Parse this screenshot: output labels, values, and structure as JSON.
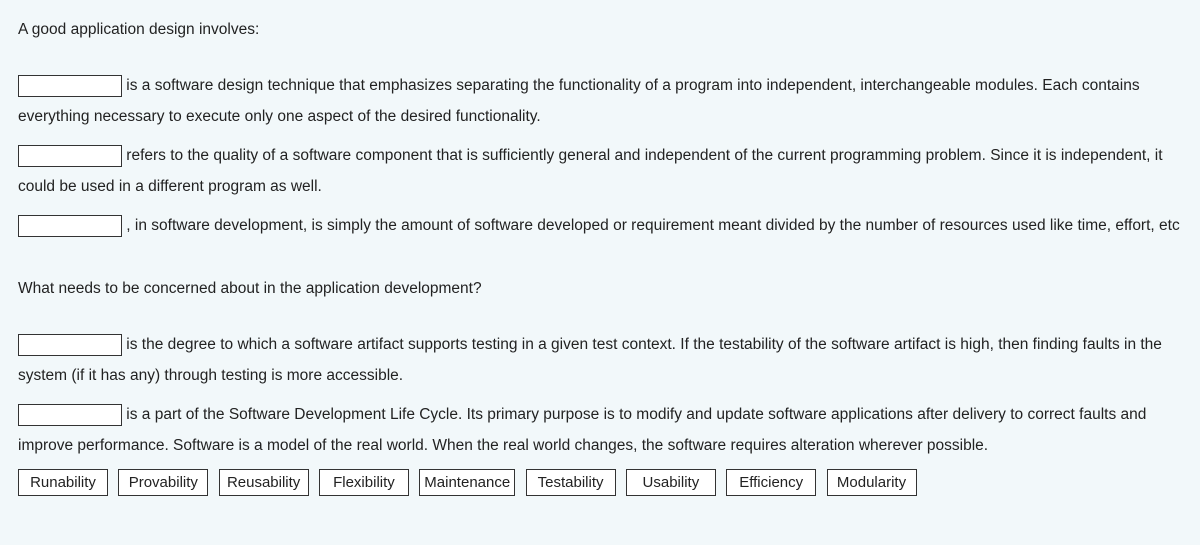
{
  "heading1": "A good application design involves:",
  "para1_after": " is a software design technique that emphasizes separating the functionality of a program into independent, interchangeable modules. Each contains everything necessary to execute only one aspect of the desired functionality.",
  "para2_after": " refers to the quality of a software component that is sufficiently general and independent of the current programming problem. Since it is independent, it could be used in a different program as well.",
  "para3_after": " , in software development, is simply the amount of software developed or requirement meant divided by the number of resources used like time, effort, etc",
  "heading2": "What needs to be concerned about in the application development?",
  "para4_after": " is the degree to which a software artifact supports testing in a given test context. If the testability of the software artifact is high, then finding faults in the system (if it has any) through testing is more accessible.",
  "para5_after": " is a part of the Software Development Life Cycle. Its primary purpose is to modify and update software applications after delivery to correct faults and improve performance. Software is a model of the real world. When the real world changes, the software requires alteration wherever possible.",
  "word_bank": {
    "0": "Runability",
    "1": "Provability",
    "2": "Reusability",
    "3": "Flexibility",
    "4": "Maintenance",
    "5": "Testability",
    "6": "Usability",
    "7": "Efficiency",
    "8": "Modularity"
  }
}
